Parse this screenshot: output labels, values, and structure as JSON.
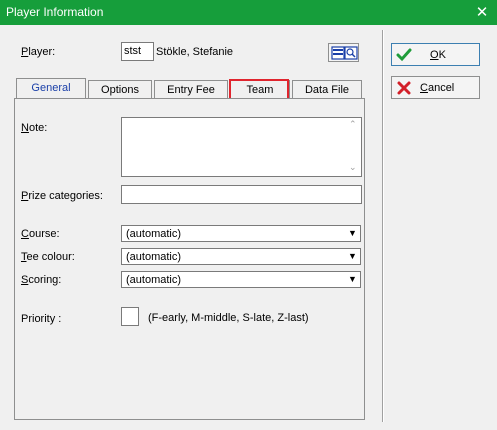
{
  "window": {
    "title": "Player Information",
    "close_glyph": "✕"
  },
  "player": {
    "label": "Player:",
    "code": "stst",
    "name": "Stökle, Stefanie"
  },
  "tabs": [
    {
      "label": "General"
    },
    {
      "label": "Options"
    },
    {
      "label": "Entry Fee"
    },
    {
      "label": "Team"
    },
    {
      "label": "Data File"
    }
  ],
  "general": {
    "note_label": "Note:",
    "prize_label": "Prize categories:",
    "course_label": "Course:",
    "course_value": "(automatic)",
    "tee_label": "Tee colour:",
    "tee_value": "(automatic)",
    "scoring_label": "Scoring:",
    "scoring_value": "(automatic)",
    "priority_label": "Priority :",
    "priority_hint": "(F-early, M-middle, S-late, Z-last)"
  },
  "buttons": {
    "ok": "OK",
    "cancel": "Cancel"
  },
  "colors": {
    "titlebar": "#169e3b",
    "tab_highlight": "#e0252e",
    "ok_check": "#1f9c3a",
    "cancel_x": "#d32029"
  }
}
